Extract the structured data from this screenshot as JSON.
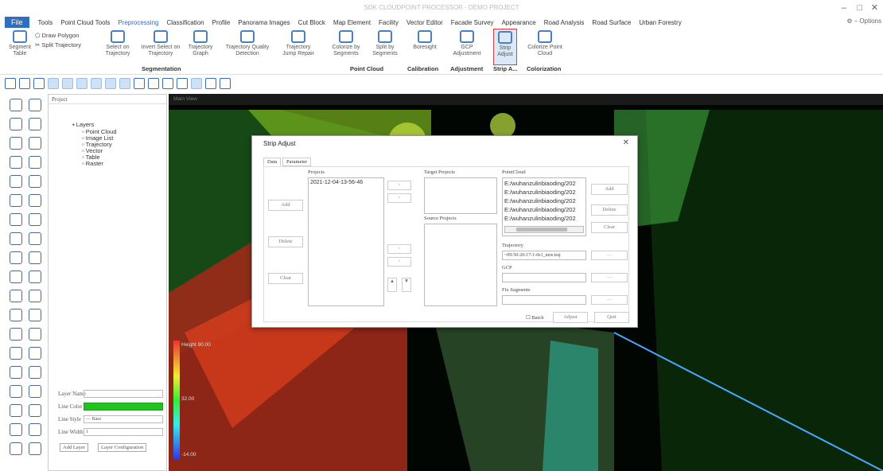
{
  "window": {
    "title": "SDK CLOUDPOINT PROCESSOR - DEMO PROJECT",
    "controls": [
      "–",
      "□",
      "✕"
    ]
  },
  "menu": {
    "file": "File",
    "items": [
      "Tools",
      "Point Cloud Tools",
      "Preprocessing",
      "Classification",
      "Profile",
      "Panorama Images",
      "Cut Block",
      "Map Element",
      "Facility",
      "Vector Editor",
      "Facade Survey",
      "Appearance",
      "Road Analysis",
      "Road Surface",
      "Urban Forestry"
    ],
    "active_index": 2,
    "options": "Options"
  },
  "ribbon": {
    "draw_polygon": "Draw Polygon",
    "split_trajectory": "Split Trajectory",
    "buttons": [
      {
        "label1": "Segment",
        "label2": "Table"
      },
      {
        "label1": "Select on",
        "label2": "Trajectory"
      },
      {
        "label1": "Invert Select on",
        "label2": "Trajectory"
      },
      {
        "label1": "Trajectory",
        "label2": "Graph"
      },
      {
        "label1": "Trajectory Quality",
        "label2": "Detection"
      },
      {
        "label1": "Trajectory",
        "label2": "Jump Repair"
      },
      {
        "label1": "Colorize by",
        "label2": "Segments"
      },
      {
        "label1": "Split by",
        "label2": "Segments"
      },
      {
        "label1": "Boresight",
        "label2": ""
      },
      {
        "label1": "GCP",
        "label2": "Adjustment"
      },
      {
        "label1": "Strip",
        "label2": "Adjust"
      },
      {
        "label1": "Colorize Point",
        "label2": "Cloud"
      }
    ],
    "groups": [
      "Segmentation",
      "Point Cloud",
      "Calibration",
      "Adjustment",
      "Strip A...",
      "Colorization"
    ]
  },
  "project_panel": {
    "header": "Project",
    "tree_root": "Layers",
    "tree_items": [
      "Point Cloud",
      "Image List",
      "Trajectory",
      "Vector",
      "Table",
      "Raster"
    ],
    "props": {
      "layer_name_label": "Layer Name",
      "layer_name_value": "",
      "line_color_label": "Line Color",
      "line_style_label": "Line Style",
      "line_style_value": "— Base",
      "line_width_label": "Line Width",
      "line_width_value": "1"
    },
    "add_layer": "Add Layer",
    "layer_config": "Layer Configuration"
  },
  "viewport": {
    "tab": "Main View",
    "scale_top": "Height 90.00",
    "scale_mid": "32.00",
    "scale_bot": "-14.00"
  },
  "dialog": {
    "title": "Strip Adjust",
    "tabs": [
      "Data",
      "Parameter"
    ],
    "projects_label": "Projects",
    "project_item": "2021-12-04-13-56-46",
    "add": "Add",
    "delete": "Delete",
    "clear": "Clear",
    "target_projects": "Target Projects",
    "source_projects": "Source Projects",
    "pointcloud_label": "PointCloud",
    "pointcloud_files": [
      "E:/wuhanzulinbiaoding/202",
      "E:/wuhanzulinbiaoding/202",
      "E:/wuhanzulinbiaoding/202",
      "E:/wuhanzulinbiaoding/202",
      "E:/wuhanzulinbiaoding/202"
    ],
    "pc_add": "Add",
    "pc_delete": "Delete",
    "pc_clear": "Clear",
    "trajectory_label": "Trajectory",
    "trajectory_value": "~09-50-20-17-1-0s1_new.traj",
    "gcp_label": "GCP",
    "fix_segments_label": "Fix Segments",
    "batch": "Batch",
    "adjust": "Adjust",
    "quit": "Quit"
  }
}
